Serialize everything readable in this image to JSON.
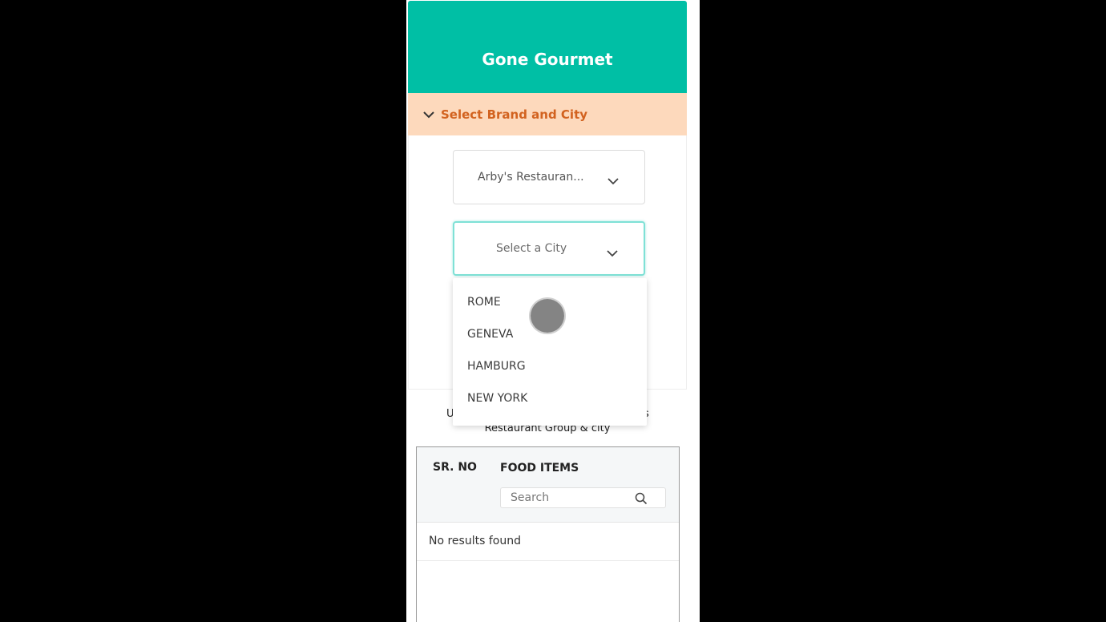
{
  "app": {
    "title": "Gone Gourmet"
  },
  "accordion": {
    "label": "Select Brand and City",
    "icon": "chevron-down-icon"
  },
  "brand_select": {
    "value": "Arby's Restauran..."
  },
  "city_select": {
    "placeholder": "Select a City"
  },
  "city_options": [
    "ROME",
    "GENEVA",
    "HAMBURG",
    "NEW YORK"
  ],
  "info": {
    "line1_left": "U",
    "line1_right": "s",
    "line2": "Restaurant Group & city"
  },
  "table": {
    "headers": [
      "SR. NO",
      "FOOD ITEMS"
    ],
    "search_placeholder": "Search",
    "empty_text": "No results found"
  },
  "colors": {
    "header_bg": "#00bfa5",
    "accordion_bg": "#fdd9bc",
    "accordion_text": "#d2621f"
  }
}
